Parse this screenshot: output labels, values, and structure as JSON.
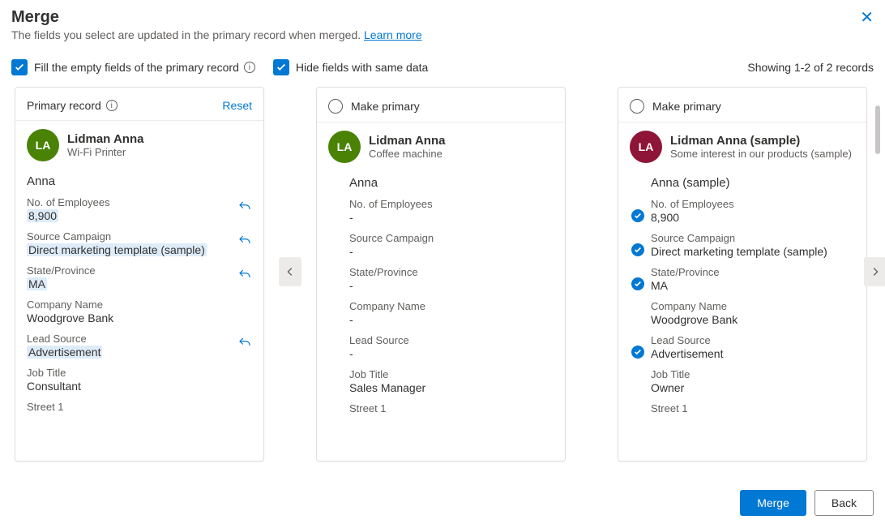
{
  "header": {
    "title": "Merge",
    "subtitle": "The fields you select are updated in the primary record when merged. ",
    "learn_more": "Learn more"
  },
  "options": {
    "fill_empty_label": "Fill the empty fields of the primary record",
    "hide_same_label": "Hide fields with same data",
    "showing": "Showing 1-2 of 2 records"
  },
  "primary_head": {
    "label": "Primary record",
    "reset": "Reset"
  },
  "make_primary_label": "Make primary",
  "avatar_initials": "LA",
  "cards": [
    {
      "name": "Lidman Anna",
      "sub": "Wi-Fi Printer",
      "display_name": "Anna",
      "fields": {
        "employees": {
          "label": "No. of Employees",
          "value": "8,900",
          "hl": true,
          "undo": true
        },
        "campaign": {
          "label": "Source Campaign",
          "value": "Direct marketing template (sample)",
          "hl": true,
          "undo": true
        },
        "state": {
          "label": "State/Province",
          "value": "MA",
          "hl": true,
          "undo": true
        },
        "company": {
          "label": "Company Name",
          "value": "Woodgrove Bank"
        },
        "leadsource": {
          "label": "Lead Source",
          "value": "Advertisement",
          "hl": true,
          "undo": true
        },
        "jobtitle": {
          "label": "Job Title",
          "value": "Consultant"
        },
        "street": {
          "label": "Street 1"
        }
      }
    },
    {
      "name": "Lidman Anna",
      "sub": "Coffee machine",
      "display_name": "Anna",
      "fields": {
        "employees": {
          "label": "No. of Employees",
          "value": "-"
        },
        "campaign": {
          "label": "Source Campaign",
          "value": "-"
        },
        "state": {
          "label": "State/Province",
          "value": "-"
        },
        "company": {
          "label": "Company Name",
          "value": "-"
        },
        "leadsource": {
          "label": "Lead Source",
          "value": "-"
        },
        "jobtitle": {
          "label": "Job Title",
          "value": "Sales Manager"
        },
        "street": {
          "label": "Street 1"
        }
      }
    },
    {
      "name": "Lidman Anna (sample)",
      "sub": "Some interest in our products (sample)",
      "display_name": "Anna (sample)",
      "fields": {
        "employees": {
          "label": "No. of Employees",
          "value": "8,900",
          "picked": true
        },
        "campaign": {
          "label": "Source Campaign",
          "value": "Direct marketing template (sample)",
          "picked": true
        },
        "state": {
          "label": "State/Province",
          "value": "MA",
          "picked": true
        },
        "company": {
          "label": "Company Name",
          "value": "Woodgrove Bank"
        },
        "leadsource": {
          "label": "Lead Source",
          "value": "Advertisement",
          "picked": true
        },
        "jobtitle": {
          "label": "Job Title",
          "value": "Owner"
        },
        "street": {
          "label": "Street 1"
        }
      }
    }
  ],
  "footer": {
    "merge": "Merge",
    "back": "Back"
  }
}
